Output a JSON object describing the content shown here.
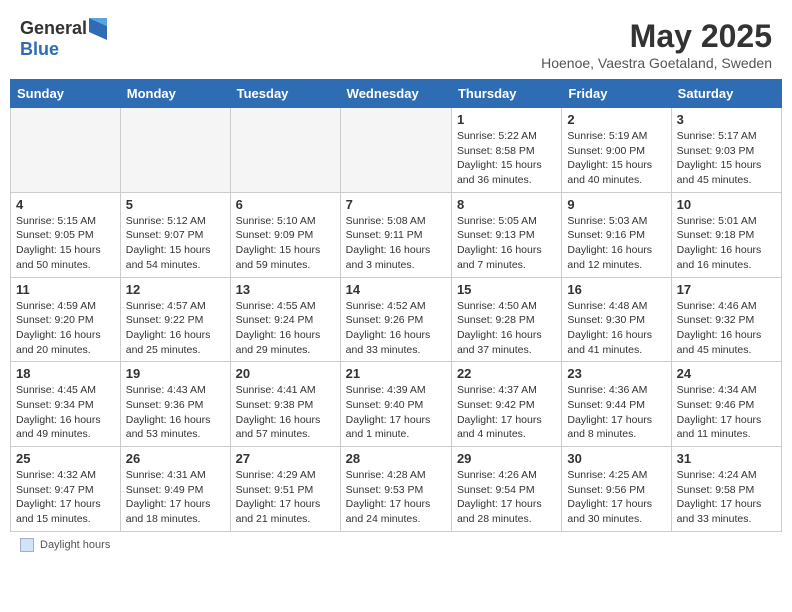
{
  "header": {
    "logo_line1": "General",
    "logo_line2": "Blue",
    "title": "May 2025",
    "subtitle": "Hoenoe, Vaestra Goetaland, Sweden"
  },
  "weekdays": [
    "Sunday",
    "Monday",
    "Tuesday",
    "Wednesday",
    "Thursday",
    "Friday",
    "Saturday"
  ],
  "weeks": [
    [
      {
        "day": "",
        "info": ""
      },
      {
        "day": "",
        "info": ""
      },
      {
        "day": "",
        "info": ""
      },
      {
        "day": "",
        "info": ""
      },
      {
        "day": "1",
        "info": "Sunrise: 5:22 AM\nSunset: 8:58 PM\nDaylight: 15 hours and 36 minutes."
      },
      {
        "day": "2",
        "info": "Sunrise: 5:19 AM\nSunset: 9:00 PM\nDaylight: 15 hours and 40 minutes."
      },
      {
        "day": "3",
        "info": "Sunrise: 5:17 AM\nSunset: 9:03 PM\nDaylight: 15 hours and 45 minutes."
      }
    ],
    [
      {
        "day": "4",
        "info": "Sunrise: 5:15 AM\nSunset: 9:05 PM\nDaylight: 15 hours and 50 minutes."
      },
      {
        "day": "5",
        "info": "Sunrise: 5:12 AM\nSunset: 9:07 PM\nDaylight: 15 hours and 54 minutes."
      },
      {
        "day": "6",
        "info": "Sunrise: 5:10 AM\nSunset: 9:09 PM\nDaylight: 15 hours and 59 minutes."
      },
      {
        "day": "7",
        "info": "Sunrise: 5:08 AM\nSunset: 9:11 PM\nDaylight: 16 hours and 3 minutes."
      },
      {
        "day": "8",
        "info": "Sunrise: 5:05 AM\nSunset: 9:13 PM\nDaylight: 16 hours and 7 minutes."
      },
      {
        "day": "9",
        "info": "Sunrise: 5:03 AM\nSunset: 9:16 PM\nDaylight: 16 hours and 12 minutes."
      },
      {
        "day": "10",
        "info": "Sunrise: 5:01 AM\nSunset: 9:18 PM\nDaylight: 16 hours and 16 minutes."
      }
    ],
    [
      {
        "day": "11",
        "info": "Sunrise: 4:59 AM\nSunset: 9:20 PM\nDaylight: 16 hours and 20 minutes."
      },
      {
        "day": "12",
        "info": "Sunrise: 4:57 AM\nSunset: 9:22 PM\nDaylight: 16 hours and 25 minutes."
      },
      {
        "day": "13",
        "info": "Sunrise: 4:55 AM\nSunset: 9:24 PM\nDaylight: 16 hours and 29 minutes."
      },
      {
        "day": "14",
        "info": "Sunrise: 4:52 AM\nSunset: 9:26 PM\nDaylight: 16 hours and 33 minutes."
      },
      {
        "day": "15",
        "info": "Sunrise: 4:50 AM\nSunset: 9:28 PM\nDaylight: 16 hours and 37 minutes."
      },
      {
        "day": "16",
        "info": "Sunrise: 4:48 AM\nSunset: 9:30 PM\nDaylight: 16 hours and 41 minutes."
      },
      {
        "day": "17",
        "info": "Sunrise: 4:46 AM\nSunset: 9:32 PM\nDaylight: 16 hours and 45 minutes."
      }
    ],
    [
      {
        "day": "18",
        "info": "Sunrise: 4:45 AM\nSunset: 9:34 PM\nDaylight: 16 hours and 49 minutes."
      },
      {
        "day": "19",
        "info": "Sunrise: 4:43 AM\nSunset: 9:36 PM\nDaylight: 16 hours and 53 minutes."
      },
      {
        "day": "20",
        "info": "Sunrise: 4:41 AM\nSunset: 9:38 PM\nDaylight: 16 hours and 57 minutes."
      },
      {
        "day": "21",
        "info": "Sunrise: 4:39 AM\nSunset: 9:40 PM\nDaylight: 17 hours and 1 minute."
      },
      {
        "day": "22",
        "info": "Sunrise: 4:37 AM\nSunset: 9:42 PM\nDaylight: 17 hours and 4 minutes."
      },
      {
        "day": "23",
        "info": "Sunrise: 4:36 AM\nSunset: 9:44 PM\nDaylight: 17 hours and 8 minutes."
      },
      {
        "day": "24",
        "info": "Sunrise: 4:34 AM\nSunset: 9:46 PM\nDaylight: 17 hours and 11 minutes."
      }
    ],
    [
      {
        "day": "25",
        "info": "Sunrise: 4:32 AM\nSunset: 9:47 PM\nDaylight: 17 hours and 15 minutes."
      },
      {
        "day": "26",
        "info": "Sunrise: 4:31 AM\nSunset: 9:49 PM\nDaylight: 17 hours and 18 minutes."
      },
      {
        "day": "27",
        "info": "Sunrise: 4:29 AM\nSunset: 9:51 PM\nDaylight: 17 hours and 21 minutes."
      },
      {
        "day": "28",
        "info": "Sunrise: 4:28 AM\nSunset: 9:53 PM\nDaylight: 17 hours and 24 minutes."
      },
      {
        "day": "29",
        "info": "Sunrise: 4:26 AM\nSunset: 9:54 PM\nDaylight: 17 hours and 28 minutes."
      },
      {
        "day": "30",
        "info": "Sunrise: 4:25 AM\nSunset: 9:56 PM\nDaylight: 17 hours and 30 minutes."
      },
      {
        "day": "31",
        "info": "Sunrise: 4:24 AM\nSunset: 9:58 PM\nDaylight: 17 hours and 33 minutes."
      }
    ]
  ],
  "footer": {
    "label": "Daylight hours"
  }
}
